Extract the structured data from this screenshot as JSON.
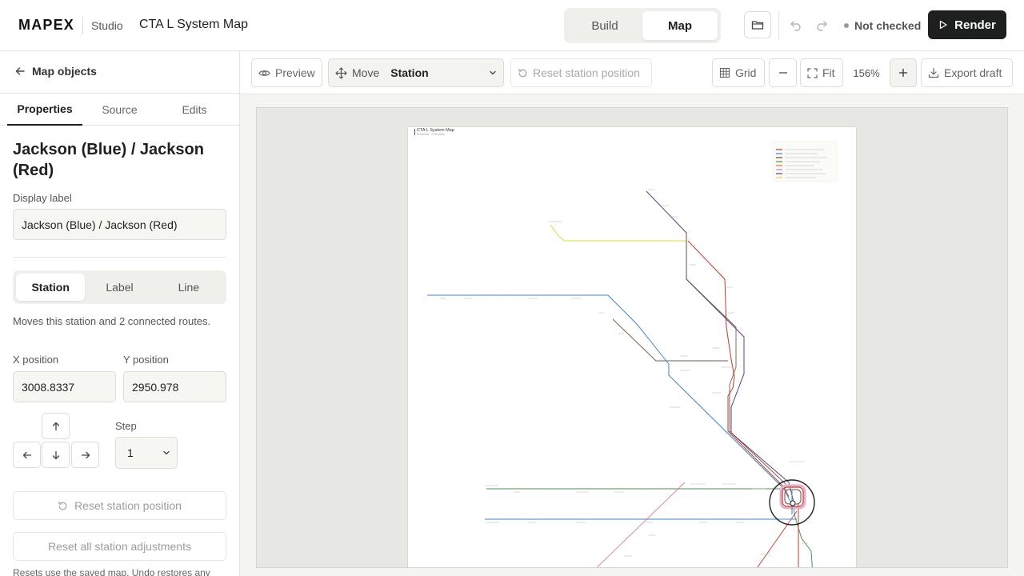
{
  "app": {
    "logo": "MAPEX",
    "studio": "Studio",
    "document_title": "CTA L System Map"
  },
  "mode_switch": {
    "items": [
      "Build",
      "Map"
    ],
    "active": "Map"
  },
  "header_actions": {
    "open_icon": "folder-icon",
    "undo_icon": "undo-icon",
    "redo_icon": "redo-icon",
    "status": "Not checked",
    "render_label": "Render"
  },
  "sidebar": {
    "back_label": "Map objects",
    "tabs": [
      "Properties",
      "Source",
      "Edits"
    ],
    "active_tab": "Properties",
    "station_title": "Jackson (Blue) / Jackson (Red)",
    "display_label_caption": "Display label",
    "display_label_value": "Jackson (Blue) / Jackson (Red)",
    "object_types": [
      "Station",
      "Label",
      "Line"
    ],
    "active_object_type": "Station",
    "hint": "Moves this station and 2 connected routes.",
    "x_caption": "X position",
    "x_value": "3008.8337",
    "y_caption": "Y position",
    "y_value": "2950.978",
    "step_caption": "Step",
    "step_value": "1",
    "reset_station": "Reset station position",
    "reset_all": "Reset all station adjustments",
    "footnote": "Resets use the saved map. Undo restores any"
  },
  "toolbar": {
    "preview": "Preview",
    "move": "Move",
    "move_target": "Station",
    "reset_station": "Reset station position",
    "grid": "Grid",
    "fit": "Fit",
    "zoom": "156%",
    "export": "Export draft"
  },
  "map_sheet": {
    "title": "CTA L System Map",
    "subtitle": "Rendered · CTA trains"
  },
  "colors": {
    "accent_dark": "#1e1f1f",
    "blue_line": "#3b86c9",
    "red_line": "#c0392b",
    "purple_line": "#5b3f8c",
    "brown_line": "#6d4a2e",
    "green_line": "#3f9a46",
    "yellow_line": "#e8d53a",
    "orange_line": "#e0772b",
    "pink_line": "#d67ba8"
  }
}
